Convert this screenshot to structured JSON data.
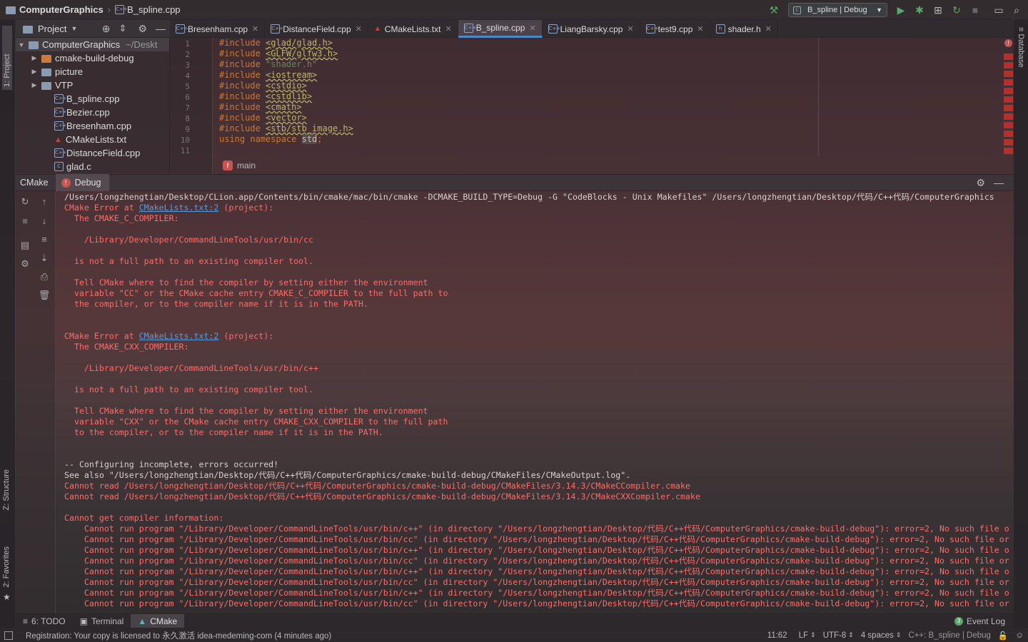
{
  "navbar": {
    "project": "ComputerGraphics",
    "file": "B_spline.cpp",
    "run_config": "B_spline | Debug"
  },
  "tool_windows": {
    "project": "1: Project",
    "structure": "Z: Structure",
    "favorites": "2: Favorites",
    "database": "Database"
  },
  "project_panel": {
    "title": "Project",
    "root": {
      "name": "ComputerGraphics",
      "path": "~/Deskt"
    },
    "items": [
      {
        "name": "cmake-build-debug",
        "kind": "folder-orange"
      },
      {
        "name": "picture",
        "kind": "folder"
      },
      {
        "name": "VTP",
        "kind": "folder"
      },
      {
        "name": "B_spline.cpp",
        "kind": "cpp"
      },
      {
        "name": "Bezier.cpp",
        "kind": "cpp"
      },
      {
        "name": "Bresenham.cpp",
        "kind": "cpp"
      },
      {
        "name": "CMakeLists.txt",
        "kind": "cmake"
      },
      {
        "name": "DistanceField.cpp",
        "kind": "cpp"
      },
      {
        "name": "glad.c",
        "kind": "c"
      }
    ]
  },
  "tabs": [
    {
      "label": "Bresenham.cpp",
      "active": false
    },
    {
      "label": "DistanceField.cpp",
      "active": false
    },
    {
      "label": "CMakeLists.txt",
      "active": false
    },
    {
      "label": "B_spline.cpp",
      "active": true
    },
    {
      "label": "LiangBarsky.cpp",
      "active": false
    },
    {
      "label": "test9.cpp",
      "active": false
    },
    {
      "label": "shader.h",
      "active": false
    }
  ],
  "editor": {
    "line_numbers": [
      "1",
      "2",
      "3",
      "4",
      "5",
      "6",
      "7",
      "8",
      "9",
      "10",
      "11"
    ],
    "lines": [
      {
        "kw": "#include",
        "arg": "<glad/glad.h>",
        "type": "inc"
      },
      {
        "kw": "#include",
        "arg": "<GLFW/glfw3.h>",
        "type": "inc"
      },
      {
        "kw": "#include",
        "arg": "\"shader.h\"",
        "type": "str"
      },
      {
        "kw": "#include",
        "arg": "<iostream>",
        "type": "inc"
      },
      {
        "kw": "#include",
        "arg": "<cstdio>",
        "type": "inc"
      },
      {
        "kw": "#include",
        "arg": "<cstdlib>",
        "type": "inc"
      },
      {
        "kw": "#include",
        "arg": "<cmath>",
        "type": "inc"
      },
      {
        "kw": "#include",
        "arg": "<vector>",
        "type": "inc"
      },
      {
        "kw": "#include",
        "arg": "<stb/stb_image.h>",
        "type": "inc"
      },
      {
        "kw": "using namespace",
        "arg": "std",
        "type": "ns"
      }
    ],
    "breadcrumb": "main",
    "breadcrumb_icon": "f"
  },
  "cmake_panel": {
    "tab": "CMake",
    "config": "Debug"
  },
  "console_lines": [
    {
      "t": "/Users/longzhengtian/Desktop/CLion.app/Contents/bin/cmake/mac/bin/cmake -DCMAKE_BUILD_TYPE=Debug -G \"CodeBlocks - Unix Makefiles\" /Users/longzhengtian/Desktop/代码/C++代码/ComputerGraphics",
      "c": "n"
    },
    {
      "t": "CMake Error at ",
      "link": "CMakeLists.txt:2",
      "after": " (project):",
      "c": "err"
    },
    {
      "t": "  The CMAKE_C_COMPILER:",
      "c": "err"
    },
    {
      "t": "",
      "c": "err"
    },
    {
      "t": "    /Library/Developer/CommandLineTools/usr/bin/cc",
      "c": "err"
    },
    {
      "t": "",
      "c": "err"
    },
    {
      "t": "  is not a full path to an existing compiler tool.",
      "c": "err"
    },
    {
      "t": "",
      "c": "err"
    },
    {
      "t": "  Tell CMake where to find the compiler by setting either the environment",
      "c": "err"
    },
    {
      "t": "  variable \"CC\" or the CMake cache entry CMAKE_C_COMPILER to the full path to",
      "c": "err"
    },
    {
      "t": "  the compiler, or to the compiler name if it is in the PATH.",
      "c": "err"
    },
    {
      "t": "",
      "c": "err"
    },
    {
      "t": "",
      "c": "err"
    },
    {
      "t": "CMake Error at ",
      "link": "CMakeLists.txt:2",
      "after": " (project):",
      "c": "err"
    },
    {
      "t": "  The CMAKE_CXX_COMPILER:",
      "c": "err"
    },
    {
      "t": "",
      "c": "err"
    },
    {
      "t": "    /Library/Developer/CommandLineTools/usr/bin/c++",
      "c": "err"
    },
    {
      "t": "",
      "c": "err"
    },
    {
      "t": "  is not a full path to an existing compiler tool.",
      "c": "err"
    },
    {
      "t": "",
      "c": "err"
    },
    {
      "t": "  Tell CMake where to find the compiler by setting either the environment",
      "c": "err"
    },
    {
      "t": "  variable \"CXX\" or the CMake cache entry CMAKE_CXX_COMPILER to the full path",
      "c": "err"
    },
    {
      "t": "  to the compiler, or to the compiler name if it is in the PATH.",
      "c": "err"
    },
    {
      "t": "",
      "c": "err"
    },
    {
      "t": "",
      "c": "err"
    },
    {
      "t": "-- Configuring incomplete, errors occurred!",
      "c": "n"
    },
    {
      "t": "See also \"/Users/longzhengtian/Desktop/代码/C++代码/ComputerGraphics/cmake-build-debug/CMakeFiles/CMakeOutput.log\".",
      "c": "n"
    },
    {
      "t": "Cannot read /Users/longzhengtian/Desktop/代码/C++代码/ComputerGraphics/cmake-build-debug/CMakeFiles/3.14.3/CMakeCCompiler.cmake",
      "c": "err"
    },
    {
      "t": "Cannot read /Users/longzhengtian/Desktop/代码/C++代码/ComputerGraphics/cmake-build-debug/CMakeFiles/3.14.3/CMakeCXXCompiler.cmake",
      "c": "err"
    },
    {
      "t": "",
      "c": "err"
    },
    {
      "t": "Cannot get compiler information:",
      "c": "err"
    },
    {
      "t": "    Cannot run program \"/Library/Developer/CommandLineTools/usr/bin/c++\" (in directory \"/Users/longzhengtian/Desktop/代码/C++代码/ComputerGraphics/cmake-build-debug\"): error=2, No such file o",
      "c": "err"
    },
    {
      "t": "    Cannot run program \"/Library/Developer/CommandLineTools/usr/bin/cc\" (in directory \"/Users/longzhengtian/Desktop/代码/C++代码/ComputerGraphics/cmake-build-debug\"): error=2, No such file or",
      "c": "err"
    },
    {
      "t": "    Cannot run program \"/Library/Developer/CommandLineTools/usr/bin/c++\" (in directory \"/Users/longzhengtian/Desktop/代码/C++代码/ComputerGraphics/cmake-build-debug\"): error=2, No such file o",
      "c": "err"
    },
    {
      "t": "    Cannot run program \"/Library/Developer/CommandLineTools/usr/bin/cc\" (in directory \"/Users/longzhengtian/Desktop/代码/C++代码/ComputerGraphics/cmake-build-debug\"): error=2, No such file or",
      "c": "err"
    },
    {
      "t": "    Cannot run program \"/Library/Developer/CommandLineTools/usr/bin/c++\" (in directory \"/Users/longzhengtian/Desktop/代码/C++代码/ComputerGraphics/cmake-build-debug\"): error=2, No such file o",
      "c": "err"
    },
    {
      "t": "    Cannot run program \"/Library/Developer/CommandLineTools/usr/bin/cc\" (in directory \"/Users/longzhengtian/Desktop/代码/C++代码/ComputerGraphics/cmake-build-debug\"): error=2, No such file or",
      "c": "err"
    },
    {
      "t": "    Cannot run program \"/Library/Developer/CommandLineTools/usr/bin/c++\" (in directory \"/Users/longzhengtian/Desktop/代码/C++代码/ComputerGraphics/cmake-build-debug\"): error=2, No such file o",
      "c": "err"
    },
    {
      "t": "    Cannot run program \"/Library/Developer/CommandLineTools/usr/bin/cc\" (in directory \"/Users/longzhengtian/Desktop/代码/C++代码/ComputerGraphics/cmake-build-debug\"): error=2, No such file or",
      "c": "err"
    }
  ],
  "bottom_tabs": [
    {
      "label": "6: TODO",
      "active": false
    },
    {
      "label": "Terminal",
      "active": false
    },
    {
      "label": "CMake",
      "active": true
    }
  ],
  "event_log": {
    "label": "Event Log",
    "count": "3"
  },
  "status": {
    "message": "Registration: Your copy is licensed to 永久激活 idea-medeming-com (4 minutes ago)",
    "position": "11:62",
    "line_sep": "LF",
    "encoding": "UTF-8",
    "indent": "4 spaces",
    "context": "C++: B_spline | Debug"
  },
  "colors": {
    "error": "#ff6b68",
    "link": "#5a9bdc",
    "accent": "#4a88c7",
    "run": "#59a869",
    "keyword": "#cc7832"
  }
}
